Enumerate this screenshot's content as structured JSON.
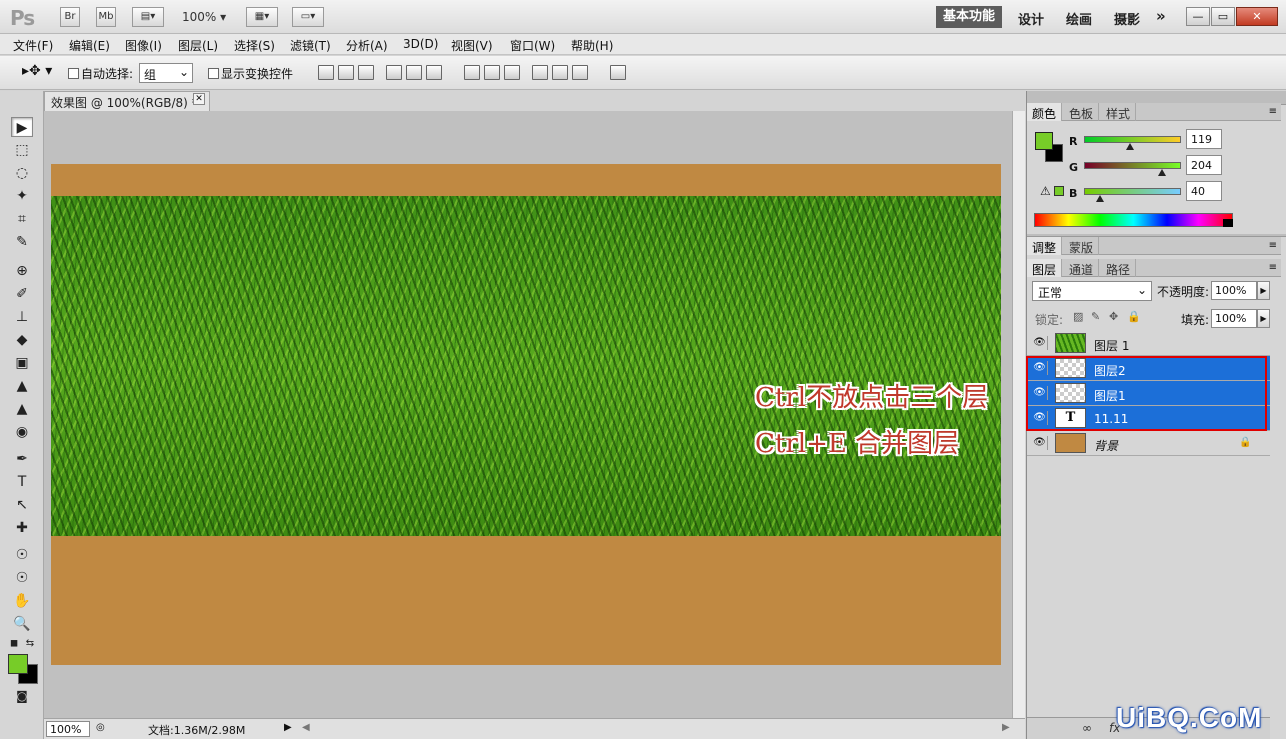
{
  "app": {
    "logo": "Ps",
    "bridge": "Br",
    "mini_bridge": "Mb",
    "zoom": "100%",
    "workspaces": [
      "基本功能",
      "设计",
      "绘画",
      "摄影"
    ],
    "more": "»"
  },
  "window_controls": {
    "minimize": "—",
    "restore": "▭",
    "close": "✕"
  },
  "menu": [
    "文件(F)",
    "编辑(E)",
    "图像(I)",
    "图层(L)",
    "选择(S)",
    "滤镜(T)",
    "分析(A)",
    "3D(D)",
    "视图(V)",
    "窗口(W)",
    "帮助(H)"
  ],
  "options": {
    "auto_select_label": "自动选择:",
    "auto_select_value": "组",
    "show_transform_label": "显示变换控件"
  },
  "tools": [
    "▶",
    "⬚",
    "◌",
    "✦",
    "⌗",
    "✎",
    "⊕",
    "✐",
    "⊥",
    "◆",
    "▣",
    "▲",
    "◉",
    "✒",
    "T",
    "↖",
    "✚",
    "☉",
    "✋",
    "🔍"
  ],
  "document": {
    "tab_title": "效果图 @ 100%(RGB/8) *",
    "close": "✕",
    "annotation_line1": "Ctrl不放点击三个层",
    "annotation_line2": "Ctrl+E 合并图层"
  },
  "status": {
    "zoom": "100%",
    "doc_info": "文档:1.36M/2.98M"
  },
  "color_panel": {
    "tabs": [
      "颜色",
      "色板",
      "样式"
    ],
    "channels": [
      {
        "label": "R",
        "value": "119",
        "pos": 0.47
      },
      {
        "label": "G",
        "value": "204",
        "pos": 0.8
      },
      {
        "label": "B",
        "value": "40",
        "pos": 0.16
      }
    ],
    "warning": "⚠"
  },
  "adjust_panel": {
    "tabs": [
      "调整",
      "蒙版"
    ]
  },
  "layers_panel": {
    "tabs": [
      "图层",
      "通道",
      "路径"
    ],
    "blend_mode": "正常",
    "opacity_label": "不透明度:",
    "opacity_value": "100%",
    "lock_label": "锁定:",
    "fill_label": "填充:",
    "fill_value": "100%",
    "layers": [
      {
        "name": "图层 1",
        "thumb": "grass",
        "selected": false
      },
      {
        "name": "图层2",
        "thumb": "check",
        "selected": true
      },
      {
        "name": "图层1",
        "thumb": "check",
        "selected": true
      },
      {
        "name": "11.11",
        "thumb": "text",
        "selected": true,
        "thumb_label": "T"
      },
      {
        "name": "背景",
        "thumb": "fill",
        "selected": false,
        "locked": true
      }
    ],
    "footer_icons": [
      "∞",
      "fx"
    ]
  },
  "colors": {
    "foreground": "#77cc28",
    "background": "#000000",
    "selection": "#1c6fd8",
    "annotation": "#c0392b",
    "canvas_fill": "#c08942"
  },
  "watermark": "UiBQ.CoM"
}
